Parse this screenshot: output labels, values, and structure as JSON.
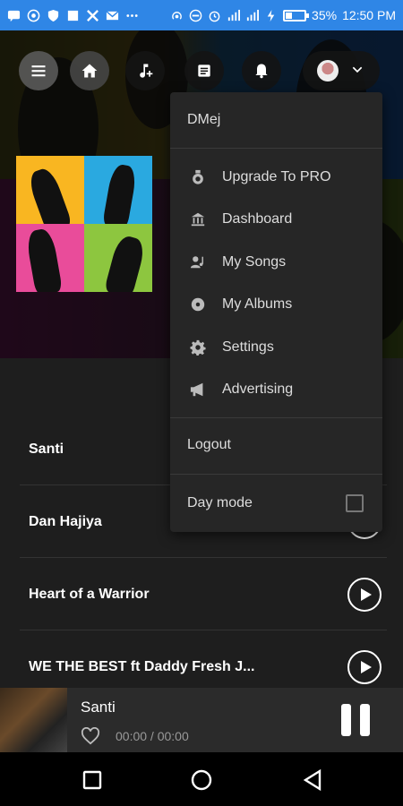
{
  "status_bar": {
    "battery_percent_text": "35%",
    "battery_level": 0.35,
    "time": "12:50 PM",
    "icons": [
      "sms-icon",
      "whatsapp-icon",
      "shield-icon",
      "notification-icon",
      "twitter-x-icon",
      "mail-icon",
      "more-icon",
      "hotspot-icon",
      "do-not-disturb-icon",
      "alarm-icon",
      "signal-icon",
      "signal-icon",
      "charging-icon",
      "battery-icon"
    ]
  },
  "toolbar": {
    "icons": [
      "menu-icon",
      "home-icon",
      "add-music-icon",
      "queue-icon",
      "bell-icon",
      "avatar",
      "chevron-down-icon"
    ]
  },
  "dropdown": {
    "username": "DMej",
    "items": [
      {
        "label": "Upgrade To PRO",
        "icon": "medal-icon"
      },
      {
        "label": "Dashboard",
        "icon": "bank-icon"
      },
      {
        "label": "My Songs",
        "icon": "artist-icon"
      },
      {
        "label": "My Albums",
        "icon": "album-icon"
      },
      {
        "label": "Settings",
        "icon": "gear-icon"
      },
      {
        "label": "Advertising",
        "icon": "megaphone-icon"
      }
    ],
    "logout": "Logout",
    "day_mode": "Day mode",
    "day_mode_checked": false
  },
  "songs": [
    {
      "title": "Santi"
    },
    {
      "title": "Dan Hajiya"
    },
    {
      "title": "Heart of a Warrior"
    },
    {
      "title": "WE THE BEST ft Daddy Fresh J..."
    }
  ],
  "player": {
    "title": "Santi",
    "time": "00:00 / 00:00",
    "state": "playing"
  },
  "colors": {
    "status_bar": "#2f86e6",
    "background": "#1e1e1e",
    "dropdown": "#262626"
  }
}
